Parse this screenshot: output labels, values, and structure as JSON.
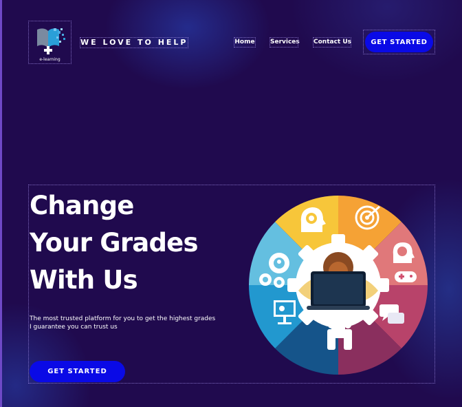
{
  "brand": {
    "logo_text": "e-learning",
    "tagline": "WE LOVE TO HELP"
  },
  "nav": {
    "items": [
      {
        "label": "Home"
      },
      {
        "label": "Services"
      },
      {
        "label": "Contact Us"
      }
    ],
    "cta_label": "GET STARTED"
  },
  "hero": {
    "title_lines": [
      "Change",
      "Your Grades",
      "With Us"
    ],
    "subtitle_lines": [
      "The most trusted platform for you to get the highest grades",
      "I guarantee you can trust us"
    ],
    "cta_label": "GET STARTED"
  },
  "illustration": {
    "segments": [
      {
        "icon": "gear-head-icon",
        "color": "#f7c63a"
      },
      {
        "icon": "target-icon",
        "color": "#f5a235"
      },
      {
        "icon": "brain-head-icon",
        "color": "#e0787a"
      },
      {
        "icon": "gamepad-icon",
        "color": "#d14f6e"
      },
      {
        "icon": "chat-bubbles-icon",
        "color": "#9a3560"
      },
      {
        "icon": "handshake-icon",
        "color": "#15548a"
      },
      {
        "icon": "presentation-icon",
        "color": "#2298cf"
      },
      {
        "icon": "gears-person-icon",
        "color": "#64bfe0"
      }
    ],
    "center_icon": "student-laptop-icon"
  },
  "colors": {
    "background": "#200a4e",
    "accent_button": "#0a0ae6",
    "left_border": "#6f49c7"
  }
}
